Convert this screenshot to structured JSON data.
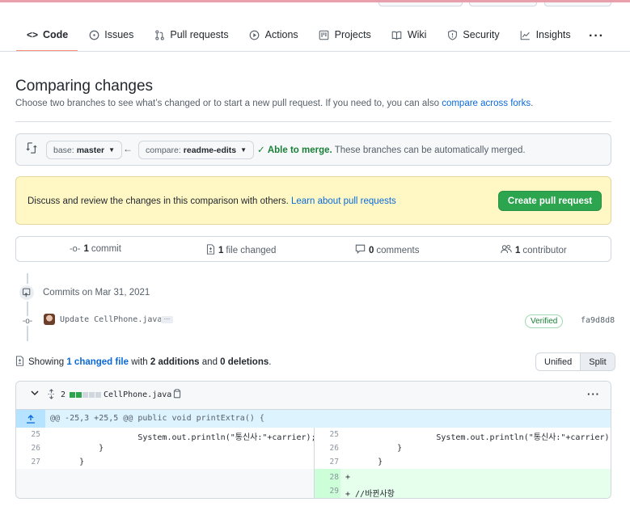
{
  "nav": {
    "tabs": [
      {
        "label": "Code",
        "icon": "code-icon",
        "active": true
      },
      {
        "label": "Issues",
        "icon": "issue-icon"
      },
      {
        "label": "Pull requests",
        "icon": "pull-request-icon"
      },
      {
        "label": "Actions",
        "icon": "play-icon"
      },
      {
        "label": "Projects",
        "icon": "project-icon"
      },
      {
        "label": "Wiki",
        "icon": "book-icon"
      },
      {
        "label": "Security",
        "icon": "shield-icon"
      },
      {
        "label": "Insights",
        "icon": "graph-icon"
      }
    ]
  },
  "page": {
    "title": "Comparing changes",
    "subtitle": "Choose two branches to see what’s changed or to start a new pull request. If you need to, you can also",
    "subtitle_link": "compare across forks",
    "subtitle_end": "."
  },
  "range": {
    "base_label": "base:",
    "base_value": "master",
    "compare_label": "compare:",
    "compare_value": "readme-edits",
    "merge_ok": "Able to merge.",
    "merge_detail": "These branches can be automatically merged."
  },
  "flash": {
    "message": "Discuss and review the changes in this comparison with others.",
    "link": "Learn about pull requests",
    "button": "Create pull request"
  },
  "summary": {
    "commits_num": "1",
    "commits_label": "commit",
    "files_num": "1",
    "files_label": "file changed",
    "comments_num": "0",
    "comments_label": "comments",
    "contributors_num": "1",
    "contributors_label": "contributor"
  },
  "commits": {
    "date": "Commits on Mar 31, 2021",
    "message": "Update CellPhone.java",
    "ellipsis": "…",
    "verified": "Verified",
    "sha": "fa9d8d8"
  },
  "files_summary": {
    "prefix": "Showing",
    "link": "1 changed file",
    "middle": "with",
    "additions": "2 additions",
    "and": "and",
    "deletions": "0 deletions",
    "suffix": ".",
    "view_unified": "Unified",
    "view_split": "Split"
  },
  "file": {
    "count": "2",
    "name": "CellPhone.java",
    "hunk": "@@ -25,3 +25,5 @@ public void printExtra() {",
    "left_lines": [
      {
        "num": "25",
        "code": "                System.out.println(\"통신사:\"+carrier);"
      },
      {
        "num": "26",
        "code": "        }"
      },
      {
        "num": "27",
        "code": "    }"
      }
    ],
    "right_lines": [
      {
        "num": "25",
        "code": "                System.out.println(\"통신사:\"+carrier);"
      },
      {
        "num": "26",
        "code": "        }"
      },
      {
        "num": "27",
        "code": "    }"
      },
      {
        "num": "28",
        "code": "+"
      },
      {
        "num": "29",
        "code": "+ //바뀐사항"
      }
    ]
  },
  "colors": {
    "accent_green": "#2da44e",
    "link_blue": "#0969da",
    "addition_bg": "#e6ffec",
    "flash_bg": "#fff8c5",
    "active_tab_underline": "#fd8c73"
  }
}
